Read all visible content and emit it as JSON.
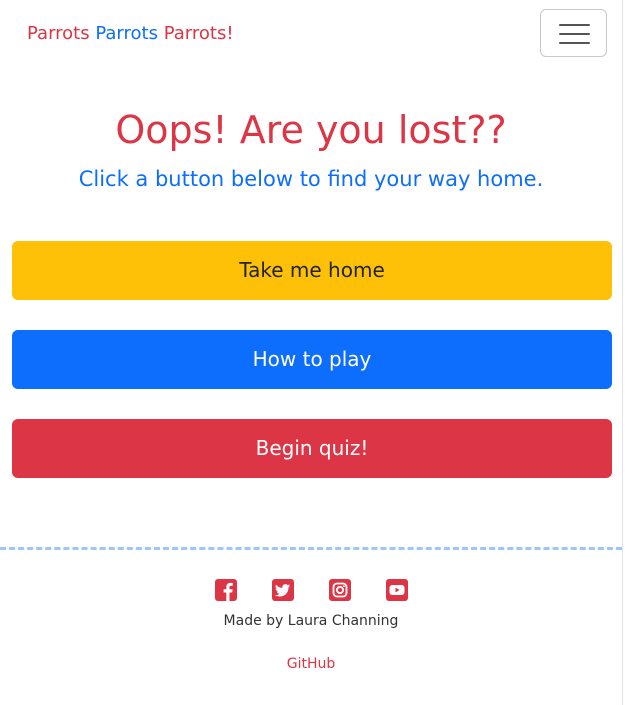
{
  "navbar": {
    "brand_part1": "Parrots",
    "brand_part2": "Parrots",
    "brand_part3": "Parrots!",
    "toggler_icon": "hamburger-menu-icon"
  },
  "main": {
    "title": "Oops! Are you lost??",
    "subtitle": "Click a button below to find your way home.",
    "buttons": [
      {
        "label": "Take me home",
        "color": "#ffc107"
      },
      {
        "label": "How to play",
        "color": "#0d6efd"
      },
      {
        "label": "Begin quiz!",
        "color": "#dc3545"
      }
    ]
  },
  "footer": {
    "social_icons": [
      "facebook-icon",
      "twitter-icon",
      "instagram-icon",
      "youtube-icon"
    ],
    "made_by": "Made by Laura Channing",
    "github_label": "GitHub"
  },
  "colors": {
    "red": "#dc3545",
    "blue": "#0d6efd",
    "yellow": "#ffc107",
    "dashed_line": "#9ec5fe"
  }
}
